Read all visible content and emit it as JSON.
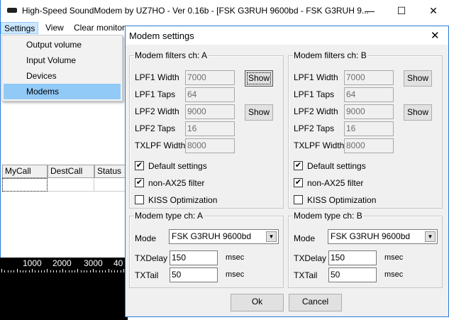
{
  "window": {
    "title": "High-Speed SoundModem by UZ7HO - Ver 0.16b - [FSK G3RUH 9600bd - FSK G3RUH 9...",
    "minimize": "—",
    "maximize": "☐",
    "close": "✕"
  },
  "menu": {
    "items": [
      "Settings",
      "View",
      "Clear monitor"
    ],
    "dropdown": [
      "Output volume",
      "Input Volume",
      "Devices",
      "Modems"
    ],
    "selected": "Modems"
  },
  "grid": {
    "columns": [
      "MyCall",
      "DestCall",
      "Status"
    ]
  },
  "ruler": {
    "labels": [
      "1000",
      "2000",
      "3000",
      "40"
    ]
  },
  "dialog": {
    "title": "Modem settings",
    "close": "✕",
    "filters": [
      {
        "title": "Modem filters ch: A",
        "lpf1_width_label": "LPF1 Width",
        "lpf1_width": "7000",
        "lpf1_taps_label": "LPF1 Taps",
        "lpf1_taps": "64",
        "lpf2_width_label": "LPF2 Width",
        "lpf2_width": "9000",
        "lpf2_taps_label": "LPF2 Taps",
        "lpf2_taps": "16",
        "txlpf_width_label": "TXLPF Width",
        "txlpf_width": "8000",
        "show": "Show",
        "default_settings": "Default settings",
        "default_checked": true,
        "nonax25": "non-AX25 filter",
        "nonax25_checked": true,
        "kiss": "KISS Optimization",
        "kiss_checked": false
      },
      {
        "title": "Modem filters ch: B",
        "lpf1_width_label": "LPF1 Width",
        "lpf1_width": "7000",
        "lpf1_taps_label": "LPF1 Taps",
        "lpf1_taps": "64",
        "lpf2_width_label": "LPF2 Width",
        "lpf2_width": "9000",
        "lpf2_taps_label": "LPF2 Taps",
        "lpf2_taps": "16",
        "txlpf_width_label": "TXLPF Width",
        "txlpf_width": "8000",
        "show": "Show",
        "default_settings": "Default settings",
        "default_checked": true,
        "nonax25": "non-AX25 filter",
        "nonax25_checked": true,
        "kiss": "KISS Optimization",
        "kiss_checked": false
      }
    ],
    "types": [
      {
        "title": "Modem type ch: A",
        "mode_label": "Mode",
        "mode": "FSK G3RUH 9600bd",
        "txdelay_label": "TXDelay",
        "txdelay": "150",
        "txtail_label": "TXTail",
        "txtail": "50",
        "unit": "msec"
      },
      {
        "title": "Modem type ch: B",
        "mode_label": "Mode",
        "mode": "FSK G3RUH 9600bd",
        "txdelay_label": "TXDelay",
        "txdelay": "150",
        "txtail_label": "TXTail",
        "txtail": "50",
        "unit": "msec"
      }
    ],
    "ok": "Ok",
    "cancel": "Cancel"
  }
}
